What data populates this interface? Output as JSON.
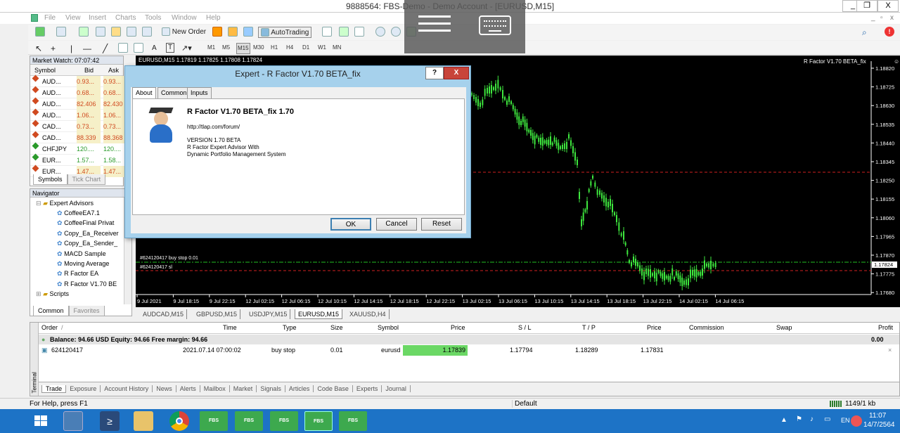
{
  "window": {
    "title": "9888564: FBS-Demo - Demo Account - [EURUSD,M15]",
    "min": "_",
    "max": "❐",
    "close": "X",
    "inner_min": "_",
    "inner_restore": "▫",
    "inner_close": "x"
  },
  "menu": [
    "File",
    "View",
    "Insert",
    "Charts",
    "Tools",
    "Window",
    "Help"
  ],
  "toolbar": {
    "new_order": "New Order",
    "autotrading": "AutoTrading",
    "timeframes": [
      "M1",
      "M5",
      "M15",
      "M30",
      "H1",
      "H4",
      "D1",
      "W1",
      "MN"
    ],
    "text_tool": "A",
    "label_tool": "T"
  },
  "market_watch": {
    "title": "Market Watch: 07:07:42",
    "headers": {
      "symbol": "Symbol",
      "bid": "Bid",
      "ask": "Ask"
    },
    "rows": [
      {
        "symbol": "AUD...",
        "bid": "0.93...",
        "ask": "0.93...",
        "dir": "down"
      },
      {
        "symbol": "AUD...",
        "bid": "0.68...",
        "ask": "0.68...",
        "dir": "down"
      },
      {
        "symbol": "AUD...",
        "bid": "82.406",
        "ask": "82.430",
        "dir": "down"
      },
      {
        "symbol": "AUD...",
        "bid": "1.06...",
        "ask": "1.06...",
        "dir": "down"
      },
      {
        "symbol": "CAD...",
        "bid": "0.73...",
        "ask": "0.73...",
        "dir": "down"
      },
      {
        "symbol": "CAD...",
        "bid": "88.339",
        "ask": "88.368",
        "dir": "down"
      },
      {
        "symbol": "CHFJPY",
        "bid": "120....",
        "ask": "120....",
        "dir": "up"
      },
      {
        "symbol": "EUR...",
        "bid": "1.57...",
        "ask": "1.58...",
        "dir": "up"
      },
      {
        "symbol": "EUR...",
        "bid": "1.47...",
        "ask": "1.47...",
        "dir": "down"
      }
    ],
    "tabs": [
      "Symbols",
      "Tick Chart"
    ]
  },
  "navigator": {
    "title": "Navigator",
    "root": "Expert Advisors",
    "items": [
      "CoffeeEA7.1",
      "CoffeeFinal Privat",
      "Copy_Ea_Receiver",
      "Copy_Ea_Sender_",
      "MACD Sample",
      "Moving Average",
      "R Factor EA",
      "R Factor V1.70 BE"
    ],
    "scripts": "Scripts",
    "tabs": [
      "Common",
      "Favorites"
    ]
  },
  "chart": {
    "header": "EURUSD,M15  1.17819 1.17825 1.17808 1.17824",
    "ea_label": "R Factor V1.70 BETA_fix",
    "prices": [
      "1.18820",
      "1.18725",
      "1.18630",
      "1.18535",
      "1.18440",
      "1.18345",
      "1.18250",
      "1.18155",
      "1.18060",
      "1.17965",
      "1.17870",
      "1.17775",
      "1.17680"
    ],
    "current_price": "1.17824",
    "times": [
      "9 Jul 2021",
      "9 Jul 18:15",
      "9 Jul 22:15",
      "12 Jul 02:15",
      "12 Jul 06:15",
      "12 Jul 10:15",
      "12 Jul 14:15",
      "12 Jul 18:15",
      "12 Jul 22:15",
      "13 Jul 02:15",
      "13 Jul 06:15",
      "13 Jul 10:15",
      "13 Jul 14:15",
      "13 Jul 18:15",
      "13 Jul 22:15",
      "14 Jul 02:15",
      "14 Jul 06:15"
    ],
    "order_line1": "#624120417 buy stop 0.01",
    "order_line2": "#624120417 sl",
    "tabs": [
      "AUDCAD,M15",
      "GBPUSD,M15",
      "USDJPY,M15",
      "EURUSD,M15",
      "XAUUSD,H4"
    ],
    "active_tab": "EURUSD,M15"
  },
  "dialog": {
    "title": "Expert - R Factor V1.70 BETA_fix",
    "help": "?",
    "close": "X",
    "tabs": [
      "About",
      "Common",
      "Inputs"
    ],
    "name": "R Factor V1.70 BETA_fix 1.70",
    "url": "http://tlap.com/forum/",
    "lines": [
      "VERSION 1.70 BETA",
      "R Factor Expert Advisor With",
      "Dynamic Portfolio Management System"
    ],
    "ok": "OK",
    "cancel": "Cancel",
    "reset": "Reset"
  },
  "terminal": {
    "side_label": "Terminal",
    "headers": {
      "order": "Order",
      "time": "Time",
      "type": "Type",
      "size": "Size",
      "symbol": "Symbol",
      "price": "Price",
      "sl": "S / L",
      "tp": "T / P",
      "price2": "Price",
      "commission": "Commission",
      "swap": "Swap",
      "profit": "Profit"
    },
    "balance": "Balance: 94.66 USD  Equity: 94.66  Free margin: 94.66",
    "balance_profit": "0.00",
    "row": {
      "order": "624120417",
      "time": "2021.07.14 07:00:02",
      "type": "buy stop",
      "size": "0.01",
      "symbol": "eurusd",
      "price": "1.17839",
      "sl": "1.17794",
      "tp": "1.18289",
      "price2": "1.17831"
    },
    "tabs": [
      "Trade",
      "Exposure",
      "Account History",
      "News",
      "Alerts",
      "Mailbox",
      "Market",
      "Signals",
      "Articles",
      "Code Base",
      "Experts",
      "Journal"
    ]
  },
  "status": {
    "help": "For Help, press F1",
    "profile": "Default",
    "traffic": "1149/1 kb"
  },
  "taskbar": {
    "fbs": "FBS",
    "lang": "EN",
    "time": "11:07",
    "date": "14/7/2564"
  }
}
